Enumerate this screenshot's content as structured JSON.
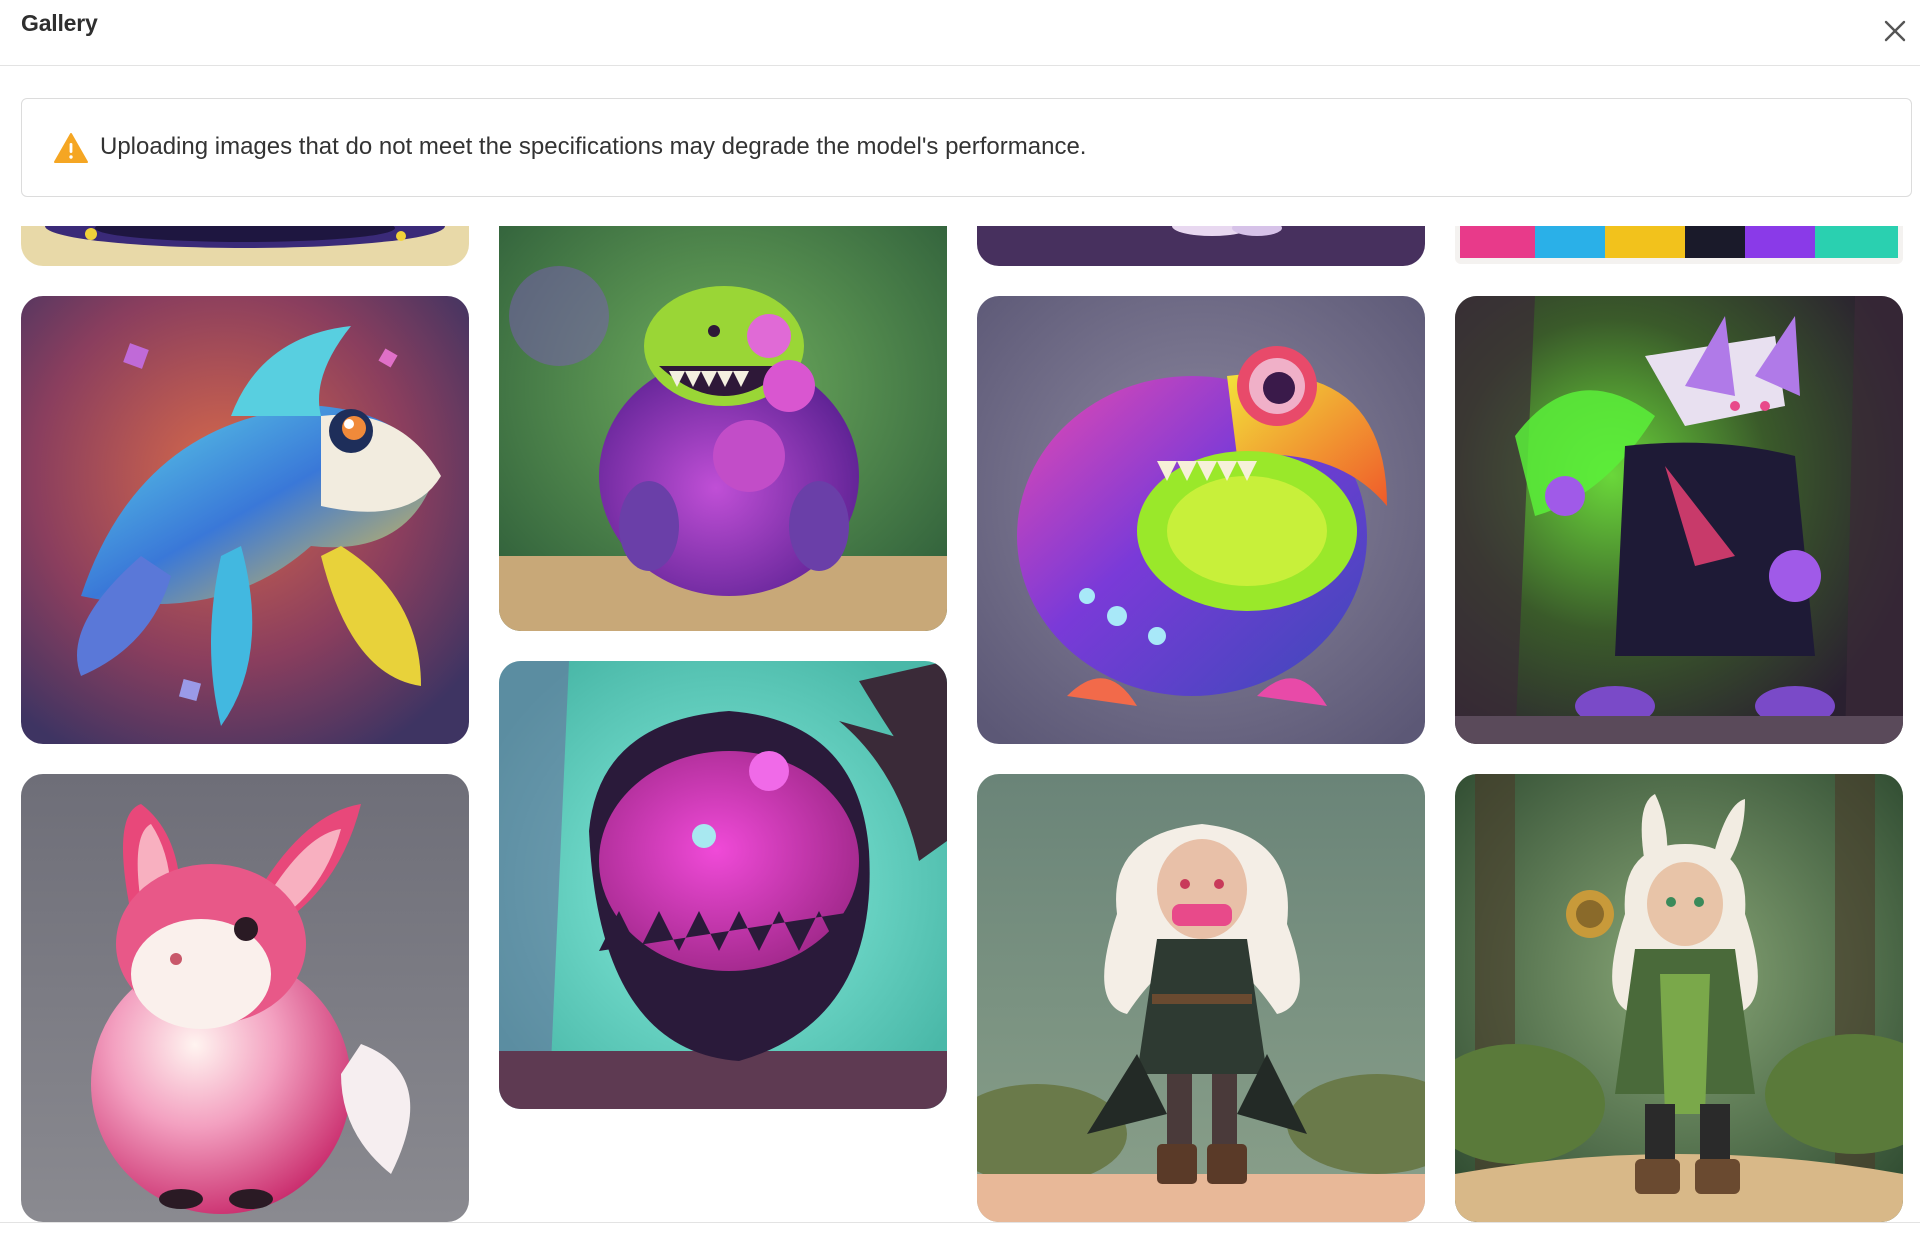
{
  "header": {
    "title": "Gallery",
    "close_icon": "close-icon"
  },
  "notice": {
    "icon": "warning-icon",
    "icon_color": "#f5a623",
    "text": "Uploading images that do not meet the specifications may degrade the model's performance."
  },
  "gallery": {
    "images": [
      {
        "subject": "cream creature partially visible"
      },
      {
        "subject": "purple green slime monster in forest"
      },
      {
        "subject": "dark purple creature partially visible"
      },
      {
        "subject": "rainbow colored creature partially visible"
      },
      {
        "subject": "iridescent shark creature"
      },
      {
        "subject": "rainbow blob fish monster"
      },
      {
        "subject": "purple rabbit warrior with green fire"
      },
      {
        "subject": "shadow monster with pink mouth in teal forest"
      },
      {
        "subject": "pink fluffy rabbit"
      },
      {
        "subject": "elf girl in dark coat"
      },
      {
        "subject": "rabbit eared elf with lantern in forest"
      }
    ]
  }
}
